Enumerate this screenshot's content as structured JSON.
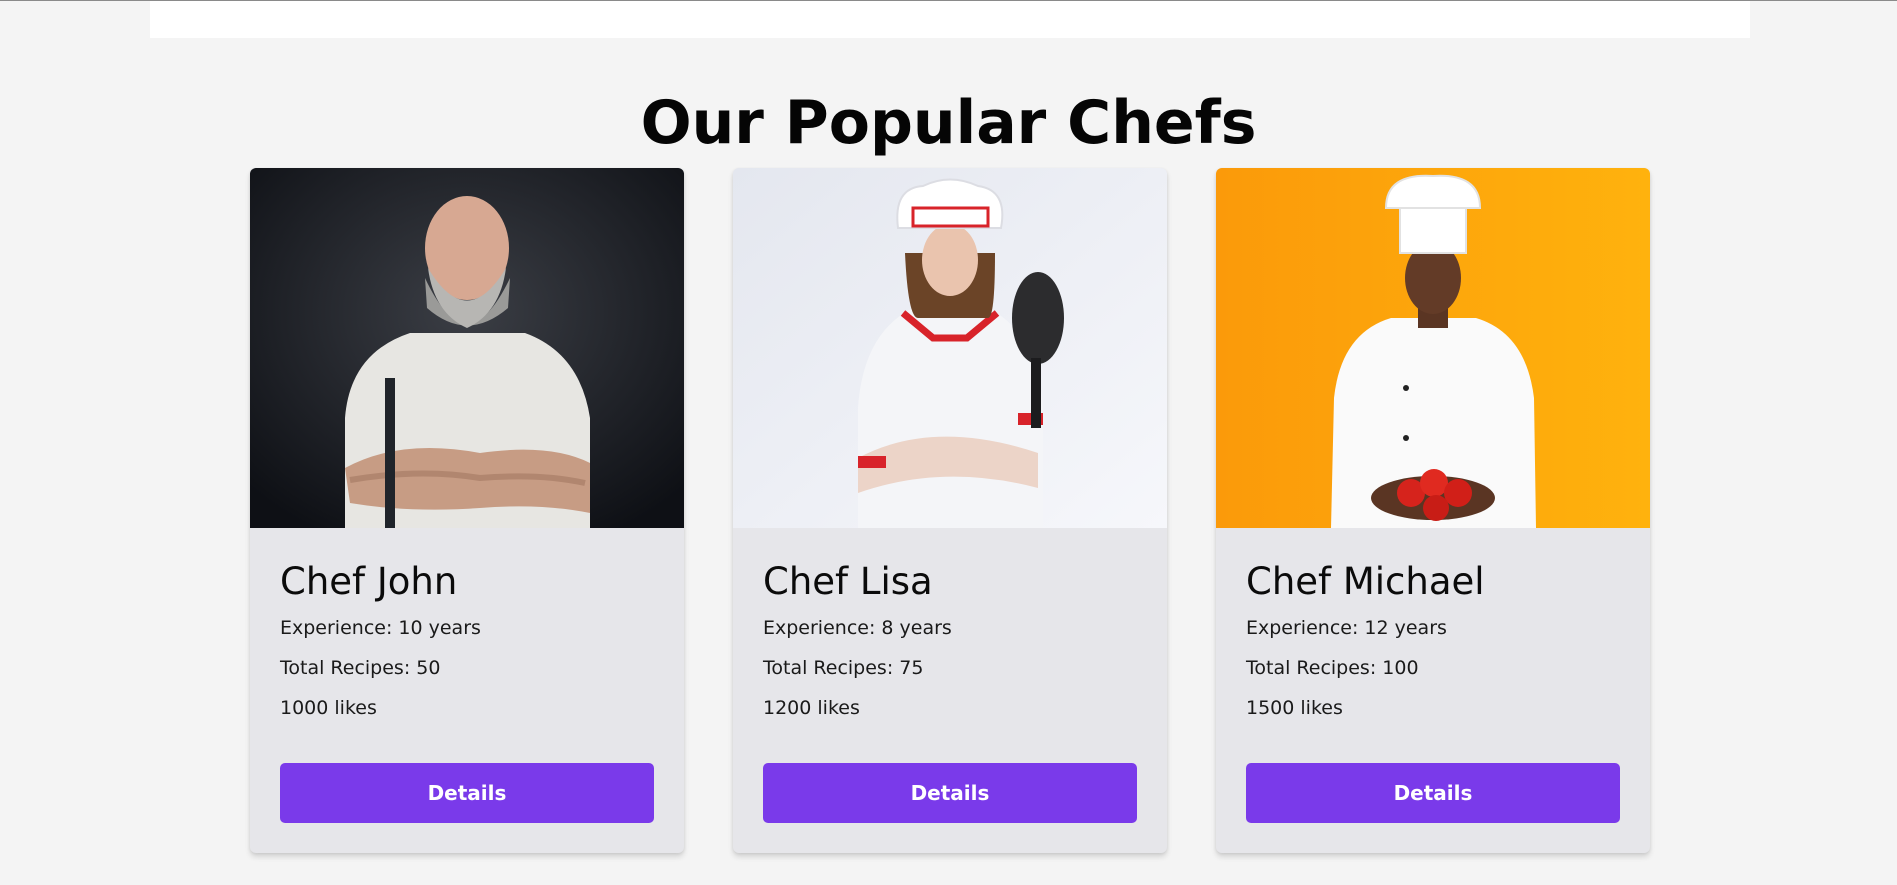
{
  "section": {
    "title": "Our Popular Chefs"
  },
  "colors": {
    "page_background": "#f4f4f4",
    "card_background": "#e6e6ea",
    "button_background": "#7a3aea",
    "button_text": "#ffffff"
  },
  "chefs": [
    {
      "name": "Chef John",
      "experience": "Experience: 10 years",
      "recipes": "Total Recipes: 50",
      "likes": "1000 likes",
      "button_label": "Details",
      "photo": "chef-john-photo"
    },
    {
      "name": "Chef Lisa",
      "experience": "Experience: 8 years",
      "recipes": "Total Recipes: 75",
      "likes": "1200 likes",
      "button_label": "Details",
      "photo": "chef-lisa-photo"
    },
    {
      "name": "Chef Michael",
      "experience": "Experience: 12 years",
      "recipes": "Total Recipes: 100",
      "likes": "1500 likes",
      "button_label": "Details",
      "photo": "chef-michael-photo"
    }
  ]
}
